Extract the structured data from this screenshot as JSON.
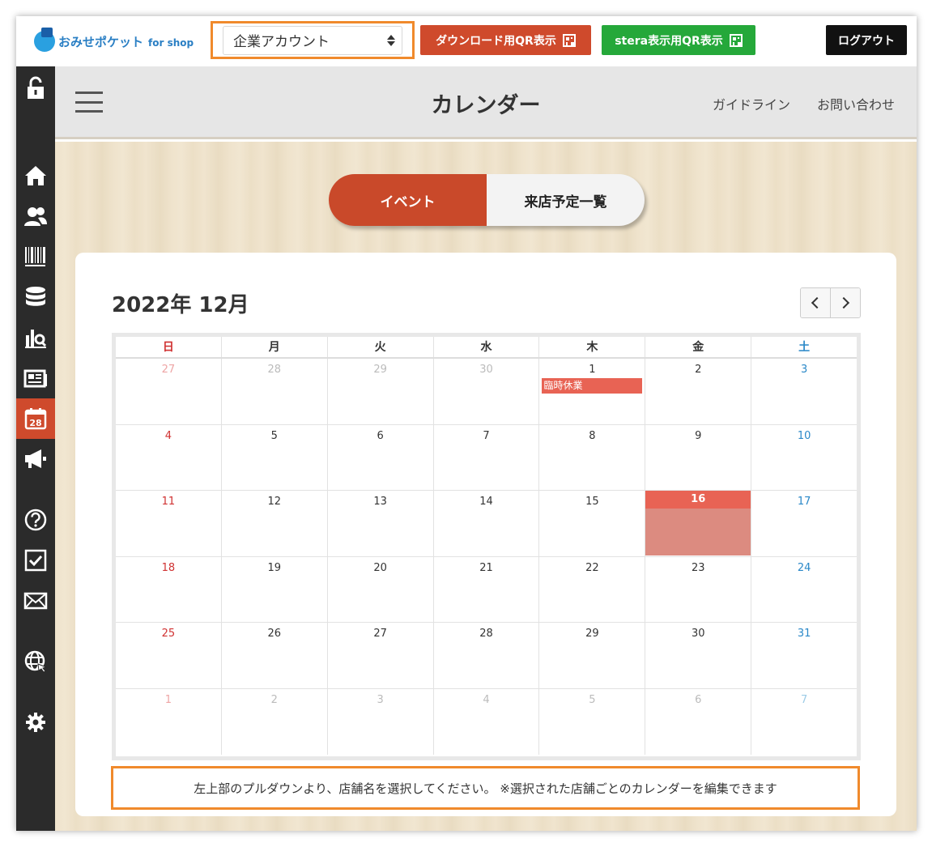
{
  "topbar": {
    "logo_text": "おみせポケット",
    "logo_suffix": "for shop",
    "account_select": {
      "selected": "企業アカウント"
    },
    "qr_download_label": "ダウンロード用QR表示",
    "qr_stera_label": "stera表示用QR表示",
    "logout_label": "ログアウト"
  },
  "sidebar": {
    "items": [
      {
        "icon": "unlock-icon"
      },
      {
        "icon": "home-icon"
      },
      {
        "icon": "users-icon"
      },
      {
        "icon": "barcode-icon"
      },
      {
        "icon": "database-icon"
      },
      {
        "icon": "analytics-icon"
      },
      {
        "icon": "news-icon"
      },
      {
        "icon": "calendar-icon",
        "badge": "28",
        "active": true
      },
      {
        "icon": "megaphone-icon"
      },
      {
        "icon": "help-icon"
      },
      {
        "icon": "checkbox-icon"
      },
      {
        "icon": "mail-icon"
      },
      {
        "icon": "globe-icon"
      },
      {
        "icon": "gear-icon"
      }
    ]
  },
  "header": {
    "title": "カレンダー",
    "guide_link": "ガイドライン",
    "contact_link": "お問い合わせ"
  },
  "tabs": [
    {
      "label": "イベント",
      "active": true
    },
    {
      "label": "来店予定一覧",
      "active": false
    }
  ],
  "calendar": {
    "month_title": "2022年 12月",
    "weekdays": [
      "日",
      "月",
      "火",
      "水",
      "木",
      "金",
      "土"
    ],
    "weeks": [
      [
        {
          "d": "27",
          "other": true
        },
        {
          "d": "28",
          "other": true
        },
        {
          "d": "29",
          "other": true
        },
        {
          "d": "30",
          "other": true
        },
        {
          "d": "1",
          "event": "臨時休業"
        },
        {
          "d": "2"
        },
        {
          "d": "3"
        }
      ],
      [
        {
          "d": "4"
        },
        {
          "d": "5"
        },
        {
          "d": "6"
        },
        {
          "d": "7"
        },
        {
          "d": "8"
        },
        {
          "d": "9"
        },
        {
          "d": "10"
        }
      ],
      [
        {
          "d": "11"
        },
        {
          "d": "12"
        },
        {
          "d": "13"
        },
        {
          "d": "14"
        },
        {
          "d": "15"
        },
        {
          "d": "16",
          "today": true
        },
        {
          "d": "17"
        }
      ],
      [
        {
          "d": "18"
        },
        {
          "d": "19"
        },
        {
          "d": "20"
        },
        {
          "d": "21"
        },
        {
          "d": "22"
        },
        {
          "d": "23"
        },
        {
          "d": "24"
        }
      ],
      [
        {
          "d": "25"
        },
        {
          "d": "26"
        },
        {
          "d": "27"
        },
        {
          "d": "28"
        },
        {
          "d": "29"
        },
        {
          "d": "30"
        },
        {
          "d": "31"
        }
      ],
      [
        {
          "d": "1",
          "other": true
        },
        {
          "d": "2",
          "other": true
        },
        {
          "d": "3",
          "other": true
        },
        {
          "d": "4",
          "other": true
        },
        {
          "d": "5",
          "other": true
        },
        {
          "d": "6",
          "other": true
        },
        {
          "d": "7",
          "other": true
        }
      ]
    ]
  },
  "notice": "左上部のプルダウンより、店舗名を選択してください。 ※選択された店舗ごとのカレンダーを編集できます",
  "colors": {
    "accent": "#cf4a2c",
    "green": "#25a83a",
    "highlight_border": "#f08a2c",
    "sunday": "#d03232",
    "saturday": "#2a88c8"
  }
}
